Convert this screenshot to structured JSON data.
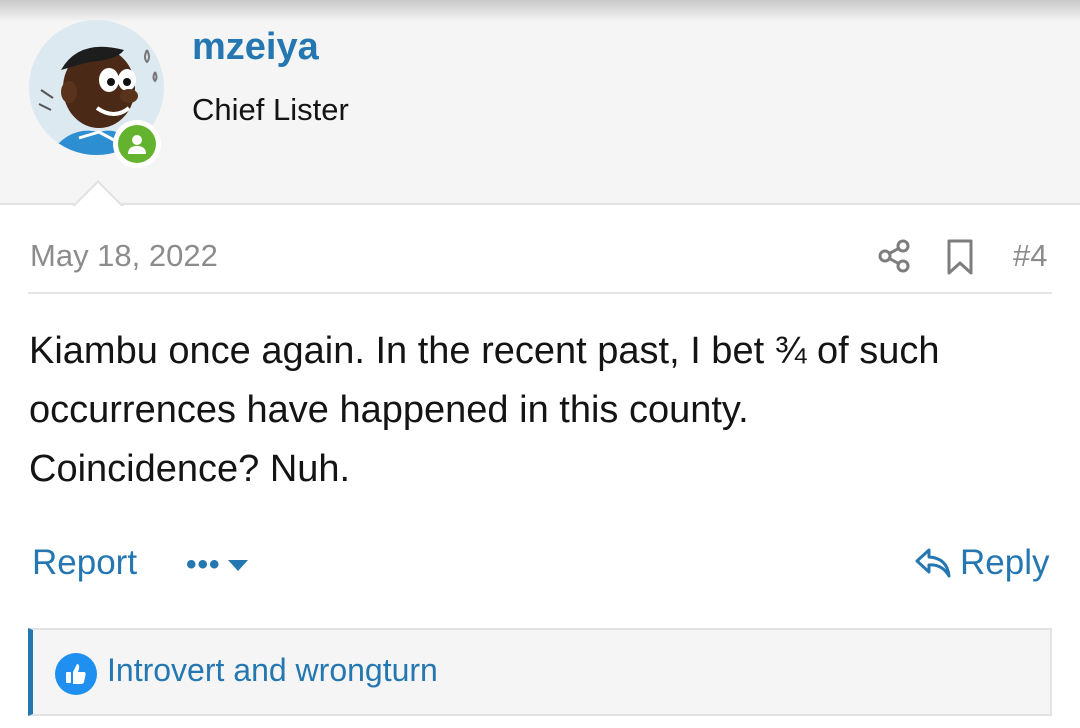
{
  "user": {
    "username": "mzeiya",
    "title": "Chief Lister",
    "avatar_icon": "cartoon-avatar-icon",
    "status_icon": "online-user-icon"
  },
  "post": {
    "date": "May 18, 2022",
    "number": "#4",
    "body_lines": [
      "Kiambu once again. In the recent past, I bet ¾ of such",
      "occurrences have happened in this county.",
      "Coincidence? Nuh."
    ]
  },
  "actions": {
    "report_label": "Report",
    "more_label": "•••",
    "reply_label": "Reply",
    "share_icon": "share-icon",
    "bookmark_icon": "bookmark-icon"
  },
  "reactions": {
    "icon": "thumbs-up-icon",
    "text": "Introvert and wrongturn"
  },
  "colors": {
    "link": "#2577b1",
    "online": "#63b32e",
    "like": "#1f8ff0",
    "header_bg": "#f5f5f5"
  }
}
